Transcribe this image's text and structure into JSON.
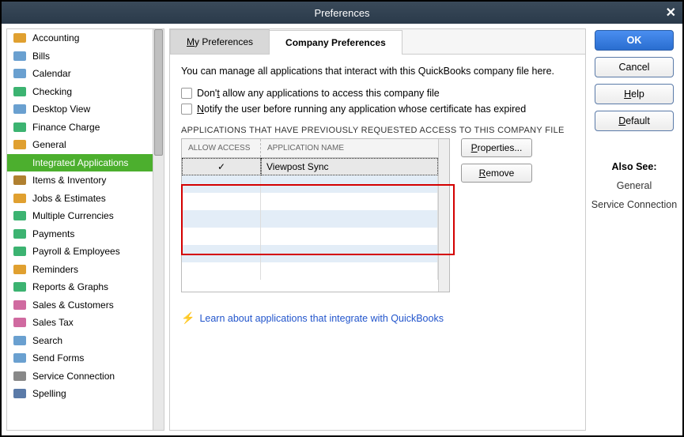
{
  "window": {
    "title": "Preferences"
  },
  "sidebar": {
    "items": [
      {
        "label": "Accounting",
        "icon": "ledger-icon",
        "color": "#e0a030"
      },
      {
        "label": "Bills",
        "icon": "bills-icon",
        "color": "#6aa0d0"
      },
      {
        "label": "Calendar",
        "icon": "calendar-icon",
        "color": "#6aa0d0"
      },
      {
        "label": "Checking",
        "icon": "check-icon",
        "color": "#3cb371"
      },
      {
        "label": "Desktop View",
        "icon": "desktop-icon",
        "color": "#6aa0d0"
      },
      {
        "label": "Finance Charge",
        "icon": "percent-icon",
        "color": "#3cb371"
      },
      {
        "label": "General",
        "icon": "gear-icon",
        "color": "#e0a030"
      },
      {
        "label": "Integrated Applications",
        "icon": "plug-icon",
        "color": "#4caf2e",
        "selected": true
      },
      {
        "label": "Items & Inventory",
        "icon": "box-icon",
        "color": "#b08030"
      },
      {
        "label": "Jobs & Estimates",
        "icon": "estimate-icon",
        "color": "#e0a030"
      },
      {
        "label": "Multiple Currencies",
        "icon": "currency-icon",
        "color": "#3cb371"
      },
      {
        "label": "Payments",
        "icon": "payment-icon",
        "color": "#3cb371"
      },
      {
        "label": "Payroll & Employees",
        "icon": "payroll-icon",
        "color": "#3cb371"
      },
      {
        "label": "Reminders",
        "icon": "clock-icon",
        "color": "#e0a030"
      },
      {
        "label": "Reports & Graphs",
        "icon": "chart-icon",
        "color": "#3cb371"
      },
      {
        "label": "Sales & Customers",
        "icon": "sales-icon",
        "color": "#d06aa0"
      },
      {
        "label": "Sales Tax",
        "icon": "tax-icon",
        "color": "#d06aa0"
      },
      {
        "label": "Search",
        "icon": "search-icon",
        "color": "#6aa0d0"
      },
      {
        "label": "Send Forms",
        "icon": "send-icon",
        "color": "#6aa0d0"
      },
      {
        "label": "Service Connection",
        "icon": "connection-icon",
        "color": "#888"
      },
      {
        "label": "Spelling",
        "icon": "spell-icon",
        "color": "#5a7aa8"
      }
    ]
  },
  "tabs": {
    "my": "My Preferences",
    "company": "Company Preferences"
  },
  "content": {
    "intro": "You can manage all applications that interact with this QuickBooks company file here.",
    "chk1_pre": "Don'",
    "chk1_u": "t",
    "chk1_post": " allow any applications to access this company file",
    "chk2_u": "N",
    "chk2_post": "otify the user before running any application whose certificate has expired",
    "section": "APPLICATIONS THAT HAVE PREVIOUSLY REQUESTED ACCESS TO THIS COMPANY FILE",
    "th_allow": "ALLOW ACCESS",
    "th_name": "APPLICATION NAME",
    "rows": [
      {
        "allow": "✓",
        "name": "Viewpost Sync",
        "selected": true
      }
    ],
    "properties_u": "P",
    "properties_post": "roperties...",
    "remove_u": "R",
    "remove_post": "emove",
    "learn": "Learn about applications that integrate with QuickBooks"
  },
  "right": {
    "ok": "OK",
    "cancel": "Cancel",
    "help_u": "H",
    "help_post": "elp",
    "default_u": "D",
    "default_post": "efault",
    "also_title": "Also See:",
    "also_items": [
      "General",
      "Service Connection"
    ]
  }
}
